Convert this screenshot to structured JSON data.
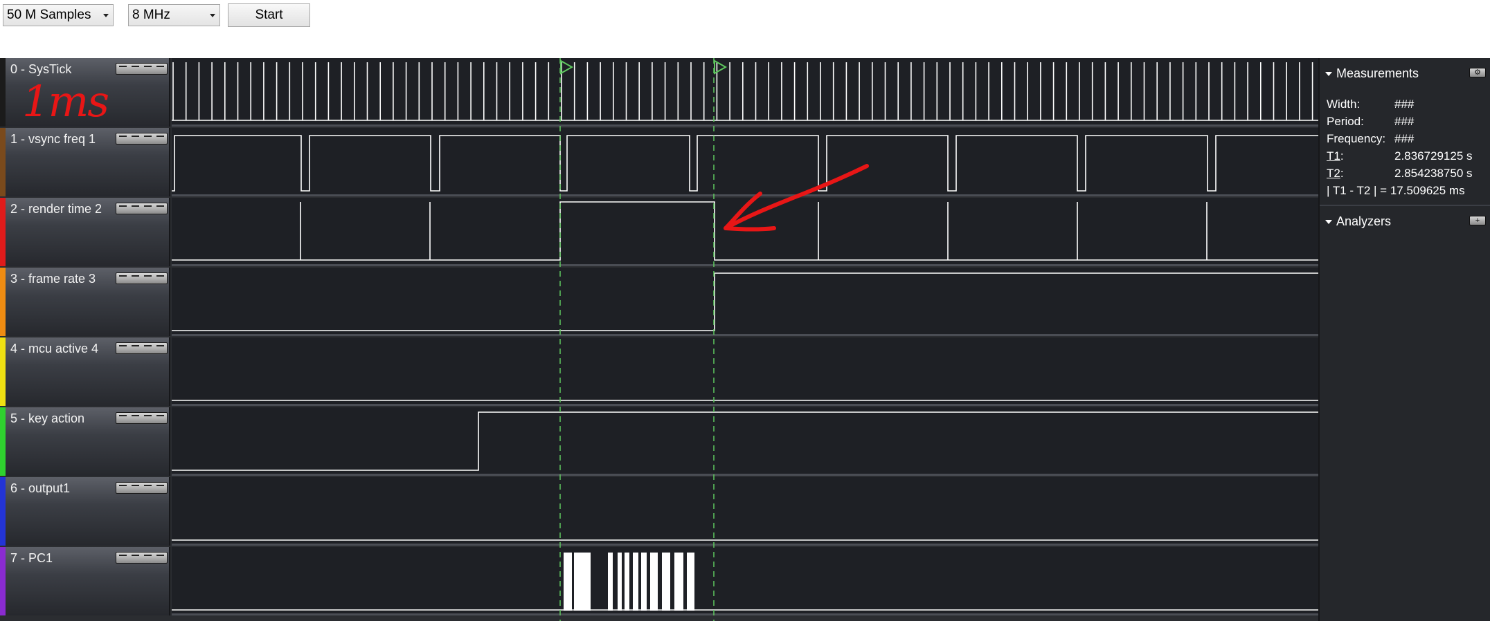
{
  "toolbar": {
    "samples": "50 M Samples",
    "rate": "8 MHz",
    "start_label": "Start"
  },
  "channels": [
    {
      "name": "0 - SysTick",
      "color": "#1b1b1b"
    },
    {
      "name": "1 - vsync freq 1",
      "color": "#7a4a1c"
    },
    {
      "name": "2 - render time 2",
      "color": "#e01b1b"
    },
    {
      "name": "3 - frame rate 3",
      "color": "#ef8c12"
    },
    {
      "name": "4 - mcu active 4",
      "color": "#efe012"
    },
    {
      "name": "5 - key action",
      "color": "#2fd12f"
    },
    {
      "name": "6 - output1",
      "color": "#2334d6"
    },
    {
      "name": "7 - PC1",
      "color": "#8a2bd0"
    }
  ],
  "annotation": {
    "text": "1ms",
    "color": "#e81616"
  },
  "measurements": {
    "title": "Measurements",
    "width_label": "Width:",
    "width_value": "###",
    "period_label": "Period:",
    "period_value": "###",
    "frequency_label": "Frequency:",
    "frequency_value": "###",
    "t1_label": "T1",
    "t1_value": "2.836729125 s",
    "t2_label": "T2",
    "t2_value": "2.854238750 s",
    "diff": "| T1 - T2 | = 17.509625 ms"
  },
  "analyzers": {
    "title": "Analyzers"
  },
  "colors": {
    "accent_red": "#e81616",
    "marker_green": "#5fc85f"
  }
}
